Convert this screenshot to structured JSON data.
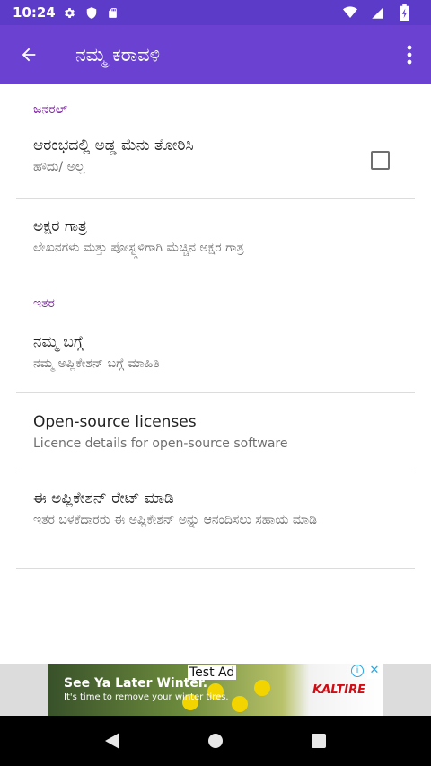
{
  "status_bar": {
    "time": "10:24",
    "icons": [
      "gear-icon",
      "shield-icon",
      "sd-card-icon",
      "wifi-icon",
      "signal-icon",
      "battery-charging-icon"
    ]
  },
  "app_bar": {
    "title": "ನಮ್ಮ ಕರಾವಳಿ",
    "back_icon": "arrow-back-icon",
    "menu_icon": "more-vert-icon"
  },
  "settings": {
    "general_category": "ಜನರಲ್",
    "other_category": "ಇತರ",
    "items": [
      {
        "title": "ಆರಂಭದಲ್ಲಿ ಅಡ್ಡ ಮೆನು ತೋರಿಸಿ",
        "summary": "ಹೌದು/ ಅಲ್ಲ",
        "checked": false
      },
      {
        "title": "ಅಕ್ಷರ ಗಾತ್ರ",
        "summary": "ಲೇಖನಗಳು ಮತ್ತು ಪೋಸ್ಟ್ಗಳಿಗಾಗಿ ಮೆಚ್ಚಿನ ಅಕ್ಷರ ಗಾತ್ರ"
      },
      {
        "title": "ನಮ್ಮ ಬಗ್ಗೆ",
        "summary": "ನಮ್ಮ ಅಪ್ಲಿಕೇಶನ್ ಬಗ್ಗೆ ಮಾಹಿತಿ"
      },
      {
        "title": "Open-source licenses",
        "summary": "Licence details for open-source software"
      },
      {
        "title": "ಈ ಅಪ್ಲಿಕೇಶನ್ ರೇಟ್ ಮಾಡಿ",
        "summary": "ಇತರ ಬಳಕೆದಾರರು ಈ ಅಪ್ಲಿಕೇಶನ್ ಅನ್ನು ಆನಂದಿಸಲು ಸಹಾಯ ಮಾಡಿ"
      }
    ]
  },
  "ad": {
    "label": "Test Ad",
    "headline": "See Ya Later Winter.",
    "subline": "It's time to remove your winter tires.",
    "brand": "KALTIRE",
    "info_glyph": "i",
    "close_glyph": "✕"
  },
  "nav_bar": {
    "icons": [
      "nav-back-icon",
      "nav-home-icon",
      "nav-recents-icon"
    ]
  },
  "colors": {
    "status_bar": "#5b3bc7",
    "app_bar": "#6a41d1",
    "category": "#7b1fa2",
    "primary_text": "#212121",
    "secondary_text": "#6f6f6f"
  }
}
